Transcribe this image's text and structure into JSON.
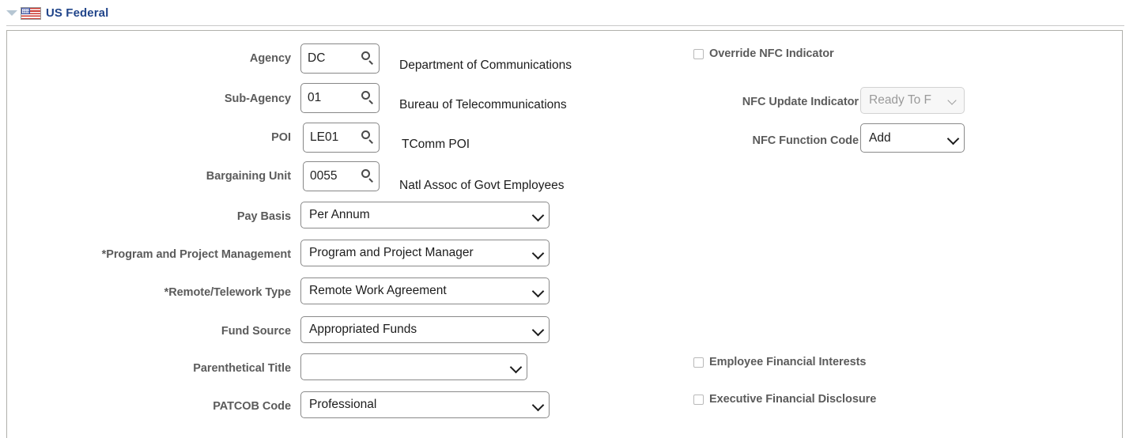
{
  "header": {
    "title": "US Federal",
    "collapse_icon": "triangle-down-icon",
    "flag_icon": "us-flag-icon"
  },
  "form": {
    "lookup_fields": [
      {
        "label": "Agency",
        "value": "DC",
        "description": "Department of Communications",
        "lookup_icon": "search-icon"
      },
      {
        "label": "Sub-Agency",
        "value": "01",
        "description": "Bureau of Telecommunications",
        "lookup_icon": "search-icon"
      },
      {
        "label": "POI",
        "value": "LE01",
        "description": "TComm POI",
        "lookup_icon": "search-icon"
      },
      {
        "label": "Bargaining Unit",
        "value": "0055",
        "description": "Natl Assoc of Govt Employees",
        "lookup_icon": "search-icon"
      }
    ],
    "dropdowns": [
      {
        "label": "Pay Basis",
        "value": "Per Annum",
        "required": false,
        "disabled": false
      },
      {
        "label": "*Program and Project Management",
        "value": "Program and Project Manager",
        "required": true,
        "disabled": false
      },
      {
        "label": "*Remote/Telework Type",
        "value": "Remote Work Agreement",
        "required": true,
        "disabled": false
      },
      {
        "label": "Fund Source",
        "value": "Appropriated Funds",
        "required": false,
        "disabled": false
      },
      {
        "label": "Parenthetical Title",
        "value": "",
        "required": false,
        "disabled": false
      },
      {
        "label": "PATCOB Code",
        "value": "Professional",
        "required": false,
        "disabled": false
      }
    ]
  },
  "right": {
    "override_nfc": {
      "label": "Override NFC Indicator",
      "checked": false
    },
    "nfc_update_indicator": {
      "label": "NFC Update Indicator",
      "value": "Ready To F",
      "disabled": true
    },
    "nfc_function_code": {
      "label": "NFC Function Code",
      "value": "Add",
      "disabled": false
    },
    "employee_financial_interests": {
      "label": "Employee Financial Interests",
      "checked": false
    },
    "executive_financial_disclosure": {
      "label": "Executive Financial Disclosure",
      "checked": false
    }
  },
  "colors": {
    "title": "#21458a",
    "label": "#5b5b5b",
    "value": "#1c1c1c",
    "border": "#878787",
    "panel_border": "#b0b0ab",
    "disabled_text": "#9a9a9a"
  }
}
